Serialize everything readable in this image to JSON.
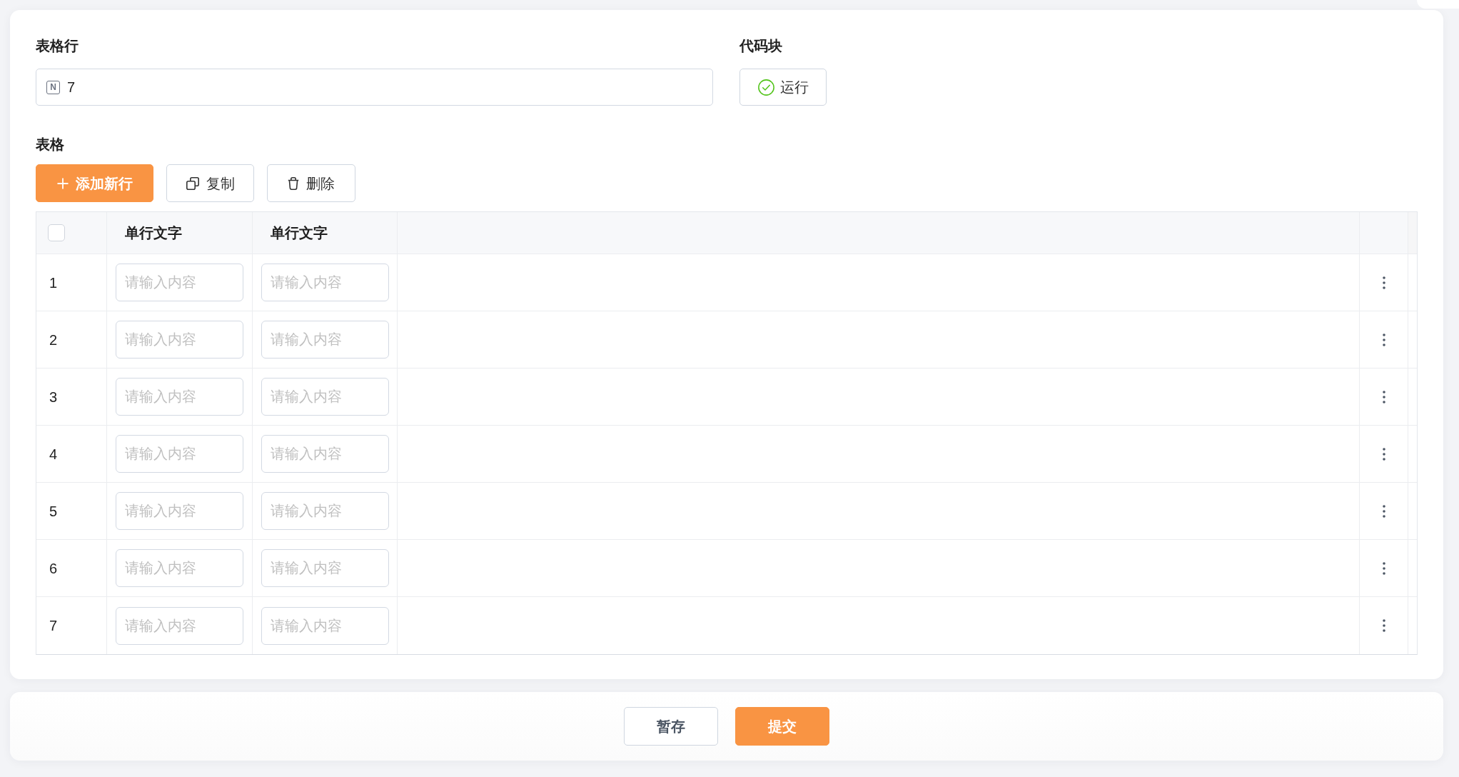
{
  "row_count": {
    "label": "表格行",
    "type_icon": "N",
    "value": "7"
  },
  "code_block": {
    "label": "代码块",
    "button": "运行"
  },
  "table_section": {
    "label": "表格",
    "toolbar": [
      {
        "kind": "add",
        "label": "添加新行"
      },
      {
        "kind": "copy",
        "label": "复制"
      },
      {
        "kind": "delete",
        "label": "删除"
      }
    ],
    "table": {
      "select_all": {
        "checked": false
      },
      "columns": [
        "单行文字",
        "单行文字"
      ],
      "rows": [
        {
          "number": "1",
          "cells": [
            {
              "placeholder": "请输入内容"
            },
            {
              "placeholder": "请输入内容"
            }
          ]
        },
        {
          "number": "2",
          "cells": [
            {
              "placeholder": "请输入内容"
            },
            {
              "placeholder": "请输入内容"
            }
          ]
        },
        {
          "number": "3",
          "cells": [
            {
              "placeholder": "请输入内容"
            },
            {
              "placeholder": "请输入内容"
            }
          ]
        },
        {
          "number": "4",
          "cells": [
            {
              "placeholder": "请输入内容"
            },
            {
              "placeholder": "请输入内容"
            }
          ]
        },
        {
          "number": "5",
          "cells": [
            {
              "placeholder": "请输入内容"
            },
            {
              "placeholder": "请输入内容"
            }
          ]
        },
        {
          "number": "6",
          "cells": [
            {
              "placeholder": "请输入内容"
            },
            {
              "placeholder": "请输入内容"
            }
          ]
        },
        {
          "number": "7",
          "cells": [
            {
              "placeholder": "请输入内容"
            },
            {
              "placeholder": "请输入内容"
            }
          ]
        }
      ]
    }
  },
  "footer": {
    "buttons": [
      {
        "kind": "secondary",
        "label": "暂存"
      },
      {
        "kind": "primary",
        "label": "提交"
      }
    ]
  }
}
